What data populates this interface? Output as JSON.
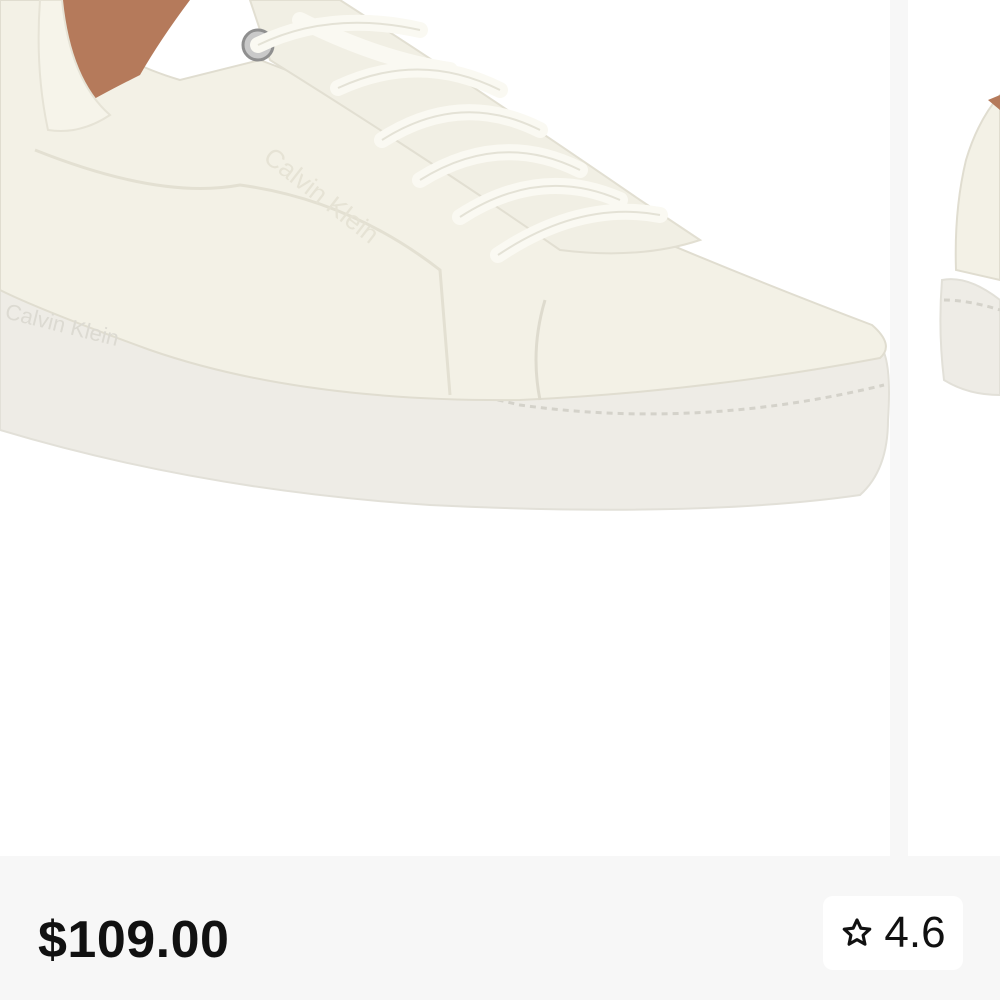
{
  "product": {
    "price": "$109.00",
    "rating": "4.6",
    "rating_icon": "star-outline-icon",
    "brand_embossing": "Calvin Klein",
    "images": [
      "white-leather-sneaker-side-view",
      "white-leather-sneaker-partial-view"
    ]
  },
  "colors": {
    "page_background": "#f7f7f7",
    "card_background": "#ffffff",
    "price_text": "#111111",
    "shoe_upper": "#f3f1e6",
    "shoe_lining": "#b57a5b"
  }
}
